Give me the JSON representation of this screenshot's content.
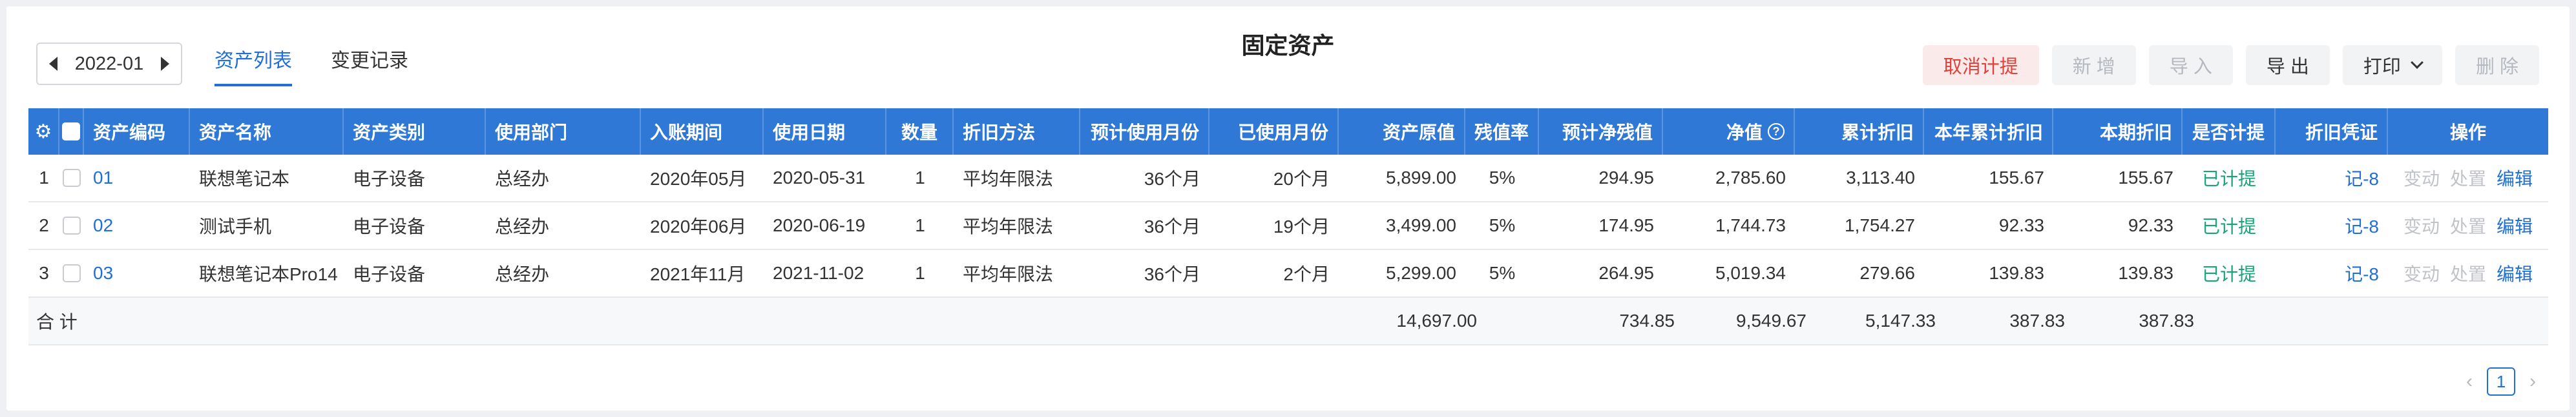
{
  "period": {
    "value": "2022-01"
  },
  "tabs": [
    {
      "label": "资产列表"
    },
    {
      "label": "变更记录"
    }
  ],
  "title": "固定资产",
  "actions": {
    "cancel": "取消计提",
    "add": "新 增",
    "import": "导 入",
    "export": "导 出",
    "print": "打印",
    "delete": "删 除"
  },
  "columns": {
    "code": "资产编码",
    "name": "资产名称",
    "category": "资产类别",
    "dept": "使用部门",
    "period": "入账期间",
    "date": "使用日期",
    "qty": "数量",
    "method": "折旧方法",
    "life": "预计使用月份",
    "used": "已使用月份",
    "orig": "资产原值",
    "rate": "残值率",
    "residual": "预计净残值",
    "net": "净值",
    "accum": "累计折旧",
    "year": "本年累计折旧",
    "current": "本期折旧",
    "accrued": "是否计提",
    "voucher": "折旧凭证",
    "ops": "操作"
  },
  "rows": [
    {
      "no": "1",
      "code": "01",
      "name": "联想笔记本",
      "category": "电子设备",
      "dept": "总经办",
      "period": "2020年05月",
      "date": "2020-05-31",
      "qty": "1",
      "method": "平均年限法",
      "life": "36个月",
      "used": "20个月",
      "orig": "5,899.00",
      "rate": "5%",
      "residual": "294.95",
      "net": "2,785.60",
      "accum": "3,113.40",
      "year": "155.67",
      "current": "155.67",
      "accrued": "已计提",
      "voucher": "记-8",
      "op1": "变动",
      "op2": "处置",
      "op3": "编辑"
    },
    {
      "no": "2",
      "code": "02",
      "name": "测试手机",
      "category": "电子设备",
      "dept": "总经办",
      "period": "2020年06月",
      "date": "2020-06-19",
      "qty": "1",
      "method": "平均年限法",
      "life": "36个月",
      "used": "19个月",
      "orig": "3,499.00",
      "rate": "5%",
      "residual": "174.95",
      "net": "1,744.73",
      "accum": "1,754.27",
      "year": "92.33",
      "current": "92.33",
      "accrued": "已计提",
      "voucher": "记-8",
      "op1": "变动",
      "op2": "处置",
      "op3": "编辑"
    },
    {
      "no": "3",
      "code": "03",
      "name": "联想笔记本Pro14",
      "category": "电子设备",
      "dept": "总经办",
      "period": "2021年11月",
      "date": "2021-11-02",
      "qty": "1",
      "method": "平均年限法",
      "life": "36个月",
      "used": "2个月",
      "orig": "5,299.00",
      "rate": "5%",
      "residual": "264.95",
      "net": "5,019.34",
      "accum": "279.66",
      "year": "139.83",
      "current": "139.83",
      "accrued": "已计提",
      "voucher": "记-8",
      "op1": "变动",
      "op2": "处置",
      "op3": "编辑"
    }
  ],
  "summary": {
    "label": "合 计",
    "orig": "14,697.00",
    "residual": "734.85",
    "net": "9,549.67",
    "accum": "5,147.33",
    "year": "387.83",
    "current": "387.83"
  },
  "pager": {
    "prev": "‹",
    "page": "1",
    "next": "›"
  }
}
